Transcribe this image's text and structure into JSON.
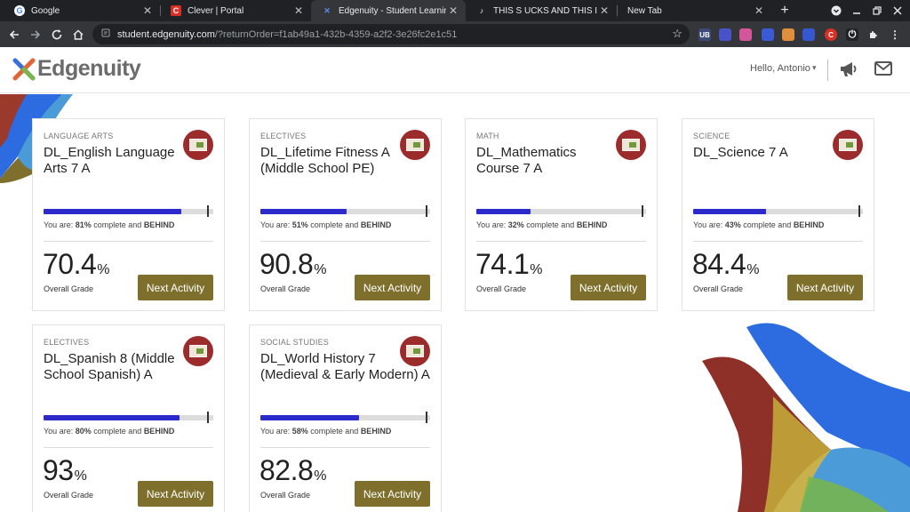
{
  "browser": {
    "tabs": [
      {
        "title": "Google",
        "favicon": "G",
        "favicon_bg": "#ffffff",
        "favicon_fg": "#4285f4"
      },
      {
        "title": "Clever | Portal",
        "favicon": "C",
        "favicon_bg": "#d93025",
        "favicon_fg": "#ffffff"
      },
      {
        "title": "Edgenuity - Student Learning E",
        "favicon": "✕",
        "favicon_bg": "#35363a",
        "favicon_fg": "#5b8def"
      },
      {
        "title": "THIS S UCKS AND THIS IBOSS",
        "favicon": "♪",
        "favicon_bg": "#202124",
        "favicon_fg": "#e8eaed"
      },
      {
        "title": "New Tab",
        "favicon": "",
        "favicon_bg": "#202124",
        "favicon_fg": "#e8eaed"
      }
    ],
    "close_glyph": "✕",
    "new_tab_glyph": "+",
    "url_host": "student.edgenuity.com",
    "url_path": "/?returnOrder=f1ab49a1-432b-4359-a2f2-3e26fc2e1c51",
    "nav_icons": [
      "back-arrow-icon",
      "forward-arrow-icon",
      "reload-icon",
      "home-icon"
    ],
    "extensions": [
      {
        "name": "ublock-icon",
        "color": "#3c4a7a",
        "label": "UB"
      },
      {
        "name": "bookmark-ext-icon",
        "color": "#4a52c8",
        "label": ""
      },
      {
        "name": "pink-ext-icon",
        "color": "#d3559a",
        "label": ""
      },
      {
        "name": "arrow-ext-icon",
        "color": "#3b5bd6",
        "label": ""
      },
      {
        "name": "folder-ext-icon",
        "color": "#e0903c",
        "label": ""
      },
      {
        "name": "blue-ext-icon",
        "color": "#3557d0",
        "label": ""
      },
      {
        "name": "clever-ext-icon",
        "color": "#d93025",
        "label": "C"
      },
      {
        "name": "power-ext-icon",
        "color": "#202124",
        "label": "⏻"
      },
      {
        "name": "puzzle-ext-icon",
        "color": "#35363a",
        "label": ""
      }
    ]
  },
  "header": {
    "logo_text": "Edgenuity",
    "greeting": "Hello, Antonio",
    "caret": "▾",
    "brand_blue": "#2d2acc",
    "accent_olive": "#7e702c"
  },
  "courses": [
    {
      "subject": "LANGUAGE ARTS",
      "title": "DL_English Language Arts 7 A",
      "progress": 81,
      "target": 97,
      "status_prefix": "You are:",
      "progress_label": "81%",
      "status_mid": "complete and",
      "status_flag": "BEHIND",
      "grade": "70.4",
      "grade_unit": "%",
      "grade_label": "Overall Grade",
      "button": "Next Activity"
    },
    {
      "subject": "ELECTIVES",
      "title": "DL_Lifetime Fitness A (Middle School PE)",
      "progress": 51,
      "target": 98,
      "status_prefix": "You are:",
      "progress_label": "51%",
      "status_mid": "complete and",
      "status_flag": "BEHIND",
      "grade": "90.8",
      "grade_unit": "%",
      "grade_label": "Overall Grade",
      "button": "Next Activity"
    },
    {
      "subject": "MATH",
      "title": "DL_Mathematics Course 7 A",
      "progress": 32,
      "target": 98,
      "status_prefix": "You are:",
      "progress_label": "32%",
      "status_mid": "complete and",
      "status_flag": "BEHIND",
      "grade": "74.1",
      "grade_unit": "%",
      "grade_label": "Overall Grade",
      "button": "Next Activity"
    },
    {
      "subject": "SCIENCE",
      "title": "DL_Science 7 A",
      "progress": 43,
      "target": 98,
      "status_prefix": "You are:",
      "progress_label": "43%",
      "status_mid": "complete and",
      "status_flag": "BEHIND",
      "grade": "84.4",
      "grade_unit": "%",
      "grade_label": "Overall Grade",
      "button": "Next Activity"
    },
    {
      "subject": "ELECTIVES",
      "title": "DL_Spanish 8 (Middle School Spanish) A",
      "progress": 80,
      "target": 97,
      "status_prefix": "You are:",
      "progress_label": "80%",
      "status_mid": "complete and",
      "status_flag": "BEHIND",
      "grade": "93",
      "grade_unit": "%",
      "grade_label": "Overall Grade",
      "button": "Next Activity"
    },
    {
      "subject": "SOCIAL STUDIES",
      "title": "DL_World History 7 (Medieval & Early Modern) A",
      "progress": 58,
      "target": 98,
      "status_prefix": "You are:",
      "progress_label": "58%",
      "status_mid": "complete and",
      "status_flag": "BEHIND",
      "grade": "82.8",
      "grade_unit": "%",
      "grade_label": "Overall Grade",
      "button": "Next Activity"
    }
  ]
}
